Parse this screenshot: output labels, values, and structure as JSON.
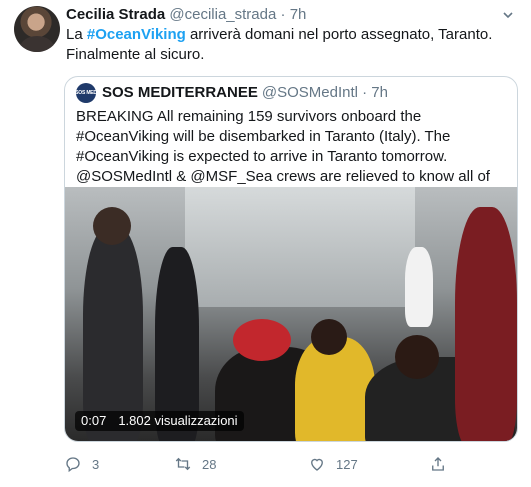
{
  "tweet": {
    "author_name": "Cecilia Strada",
    "author_handle": "@cecilia_strada",
    "separator": "·",
    "time": "7h",
    "text_before": "La ",
    "hashtag": "#OceanViking",
    "text_after": " arriverà domani nel porto assegnato, Taranto. Finalmente al sicuro."
  },
  "quote": {
    "avatar_text": "SOS MED",
    "author_name": "SOS MEDITERRANEE",
    "author_handle": "@SOSMedIntl",
    "separator": "·",
    "time": "7h",
    "text": "BREAKING All remaining 159 survivors onboard the #OceanViking will be disembarked in Taranto (Italy). The #OceanViking is expected to arrive in Taranto tomorrow. @SOSMedIntl & @MSF_Sea crews are relieved to know all of them will finally reach safety.",
    "video": {
      "duration": "0:07",
      "views": "1.802 visualizzazioni"
    }
  },
  "actions": {
    "reply_count": "3",
    "retweet_count": "28",
    "like_count": "127"
  },
  "icons": [
    "more-caret-icon",
    "reply-icon",
    "retweet-icon",
    "like-icon",
    "share-icon"
  ],
  "colors": {
    "link": "#1da1f2",
    "muted": "#657786",
    "border": "#ccd6dd"
  }
}
